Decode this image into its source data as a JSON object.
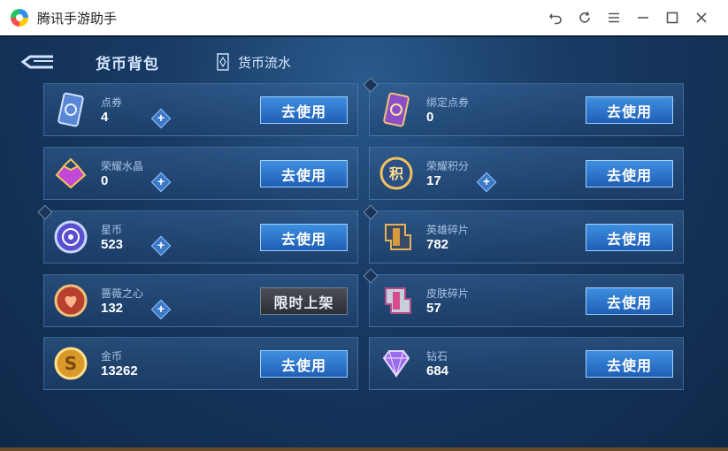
{
  "window": {
    "title": "腾讯手游助手"
  },
  "header": {
    "page_title": "货币背包",
    "flow_link": "货币流水"
  },
  "cards": [
    {
      "name": "点券",
      "amount": "4",
      "button": "去使用",
      "has_plus": true
    },
    {
      "name": "绑定点券",
      "amount": "0",
      "button": "去使用",
      "has_plus": false
    },
    {
      "name": "荣耀水晶",
      "amount": "0",
      "button": "去使用",
      "has_plus": true
    },
    {
      "name": "荣耀积分",
      "amount": "17",
      "button": "去使用",
      "has_plus": true
    },
    {
      "name": "星币",
      "amount": "523",
      "button": "去使用",
      "has_plus": true
    },
    {
      "name": "英雄碎片",
      "amount": "782",
      "button": "去使用",
      "has_plus": false
    },
    {
      "name": "蔷薇之心",
      "amount": "132",
      "button": "限时上架",
      "has_plus": true
    },
    {
      "name": "皮肤碎片",
      "amount": "57",
      "button": "去使用",
      "has_plus": false
    },
    {
      "name": "金币",
      "amount": "13262",
      "button": "去使用",
      "has_plus": false
    },
    {
      "name": "钻石",
      "amount": "684",
      "button": "去使用",
      "has_plus": false
    }
  ],
  "icons": {
    "card_icons": [
      "coupon-icon",
      "bound-coupon-icon",
      "glory-crystal-icon",
      "glory-points-icon",
      "star-coin-icon",
      "hero-shard-icon",
      "rose-heart-icon",
      "skin-shard-icon",
      "gold-coin-icon",
      "diamond-icon"
    ]
  },
  "colors": {
    "accent": "#2f7fd6",
    "background": "#183a63"
  }
}
